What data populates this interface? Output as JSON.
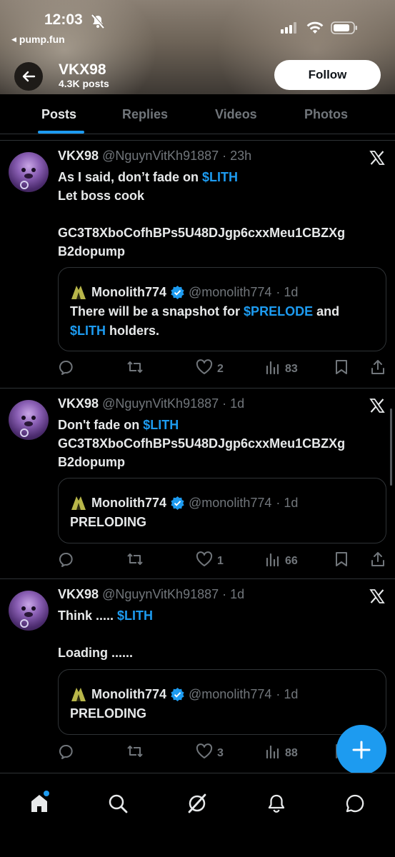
{
  "status_bar": {
    "time": "12:03",
    "back_app": "pump.fun"
  },
  "header": {
    "name": "VKX98",
    "posts_count": "4.3K posts",
    "follow_label": "Follow"
  },
  "tabs": [
    {
      "label": "Posts",
      "active": true
    },
    {
      "label": "Replies",
      "active": false
    },
    {
      "label": "Videos",
      "active": false
    },
    {
      "label": "Photos",
      "active": false
    }
  ],
  "posts": [
    {
      "name": "VKX98",
      "handle": "@NguynVitKh91887",
      "time": "· 23h",
      "body": [
        [
          {
            "t": "As I said, don’t fade on "
          },
          {
            "t": "$LITH",
            "cash": true
          }
        ],
        [
          {
            "t": "Let boss cook"
          }
        ],
        [
          {
            "t": ""
          }
        ],
        [
          {
            "t": "GC3T8XboCofhBPs5U48DJgp6cxxMeu1CBZXg"
          }
        ],
        [
          {
            "t": "B2dopump"
          }
        ]
      ],
      "quote": {
        "name": "Monolith774",
        "handle": "@monolith774",
        "time": "· 1d",
        "body": [
          [
            {
              "t": "There will be a snapshot for "
            },
            {
              "t": "$PRELODE",
              "cash": true
            },
            {
              "t": " and"
            }
          ],
          [
            {
              "t": "$LITH",
              "cash": true
            },
            {
              "t": " holders."
            }
          ]
        ]
      },
      "stats": {
        "likes": "2",
        "views": "83"
      }
    },
    {
      "name": "VKX98",
      "handle": "@NguynVitKh91887",
      "time": "· 1d",
      "body": [
        [
          {
            "t": "Don't fade on "
          },
          {
            "t": "$LITH",
            "cash": true
          }
        ],
        [
          {
            "t": "GC3T8XboCofhBPs5U48DJgp6cxxMeu1CBZXg"
          }
        ],
        [
          {
            "t": "B2dopump"
          }
        ]
      ],
      "quote": {
        "name": "Monolith774",
        "handle": "@monolith774",
        "time": "· 1d",
        "body": [
          [
            {
              "t": "PRELODING"
            }
          ]
        ]
      },
      "stats": {
        "likes": "1",
        "views": "66"
      }
    },
    {
      "name": "VKX98",
      "handle": "@NguynVitKh91887",
      "time": "· 1d",
      "body": [
        [
          {
            "t": "Think ..... "
          },
          {
            "t": "$LITH",
            "cash": true
          }
        ],
        [
          {
            "t": ""
          }
        ],
        [
          {
            "t": "Loading ......"
          }
        ]
      ],
      "quote": {
        "name": "Monolith774",
        "handle": "@monolith774",
        "time": "· 1d",
        "body": [
          [
            {
              "t": "PRELODING"
            }
          ]
        ]
      },
      "stats": {
        "likes": "3",
        "views": "88"
      }
    }
  ],
  "colors": {
    "accent": "#1d9bf0",
    "muted": "#71767b",
    "text": "#e7e9ea",
    "border": "#2f3336"
  },
  "bottom_nav": [
    "home-icon",
    "search-icon",
    "grok-icon",
    "notifications-icon",
    "messages-icon"
  ]
}
